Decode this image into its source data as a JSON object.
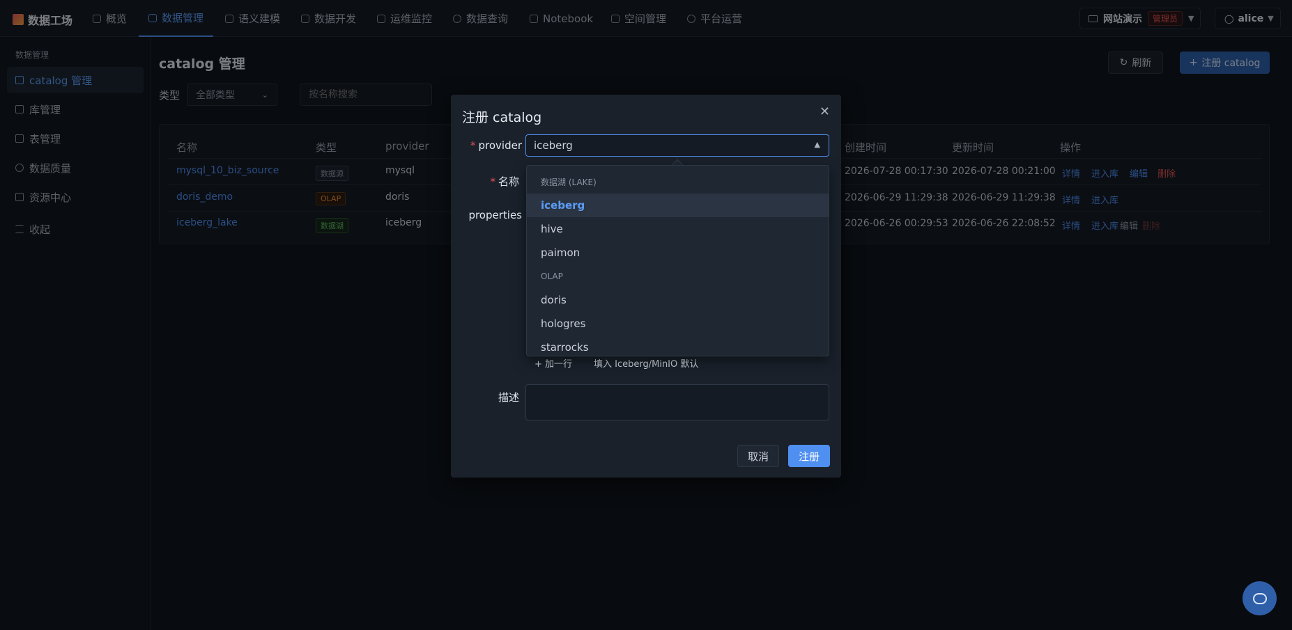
{
  "app": {
    "logo": "数据工场"
  },
  "nav": [
    {
      "label": "概览"
    },
    {
      "label": "数据管理"
    },
    {
      "label": "语义建模"
    },
    {
      "label": "数据开发"
    },
    {
      "label": "运维监控"
    },
    {
      "label": "数据查询"
    },
    {
      "label": "Notebook"
    },
    {
      "label": "空间管理"
    },
    {
      "label": "平台运营"
    }
  ],
  "workspace": {
    "name": "网站演示",
    "role": "管理员"
  },
  "user": {
    "name": "alice"
  },
  "sidebar": {
    "section": "数据管理",
    "items": [
      {
        "label": "catalog 管理"
      },
      {
        "label": "库管理"
      },
      {
        "label": "表管理"
      },
      {
        "label": "数据质量"
      },
      {
        "label": "资源中心"
      },
      {
        "label": "收起"
      }
    ]
  },
  "page": {
    "title": "catalog 管理",
    "refresh": "刷新",
    "register": "注册 catalog",
    "filter_label": "类型",
    "filter_value": "全部类型",
    "search_placeholder": "按名称搜索"
  },
  "table": {
    "headers": [
      "名称",
      "类型",
      "provider",
      "创建时间",
      "更新时间",
      "操作"
    ],
    "rows": [
      {
        "name": "mysql_10_biz_source",
        "type": "数据源",
        "provider": "mysql",
        "created": "2026-07-28 00:17:30",
        "updated": "2026-07-28 00:21:00",
        "ops": [
          "详情",
          "进入库",
          "编辑",
          "删除"
        ]
      },
      {
        "name": "doris_demo",
        "type": "OLAP",
        "provider": "doris",
        "created": "2026-06-29 11:29:38",
        "updated": "2026-06-29 11:29:38",
        "ops": [
          "详情",
          "进入库"
        ]
      },
      {
        "name": "iceberg_lake",
        "type": "数据湖",
        "provider": "iceberg",
        "created": "2026-06-26 00:29:53",
        "updated": "2026-06-26 22:08:52",
        "ops": [
          "详情",
          "进入库",
          "编辑",
          "删除"
        ]
      }
    ]
  },
  "modal": {
    "title": "注册 catalog",
    "provider_label": "provider",
    "provider_value": "iceberg",
    "name_label": "名称",
    "properties_label": "properties",
    "add_row": "加一行",
    "fill_default": "填入 Iceberg/MinIO 默认",
    "desc_label": "描述",
    "cancel": "取消",
    "submit": "注册"
  },
  "dropdown": {
    "groups": [
      {
        "label": "数据湖 (LAKE)",
        "options": [
          "iceberg",
          "hive",
          "paimon"
        ]
      },
      {
        "label": "OLAP",
        "options": [
          "doris",
          "hologres",
          "starrocks"
        ]
      }
    ]
  }
}
